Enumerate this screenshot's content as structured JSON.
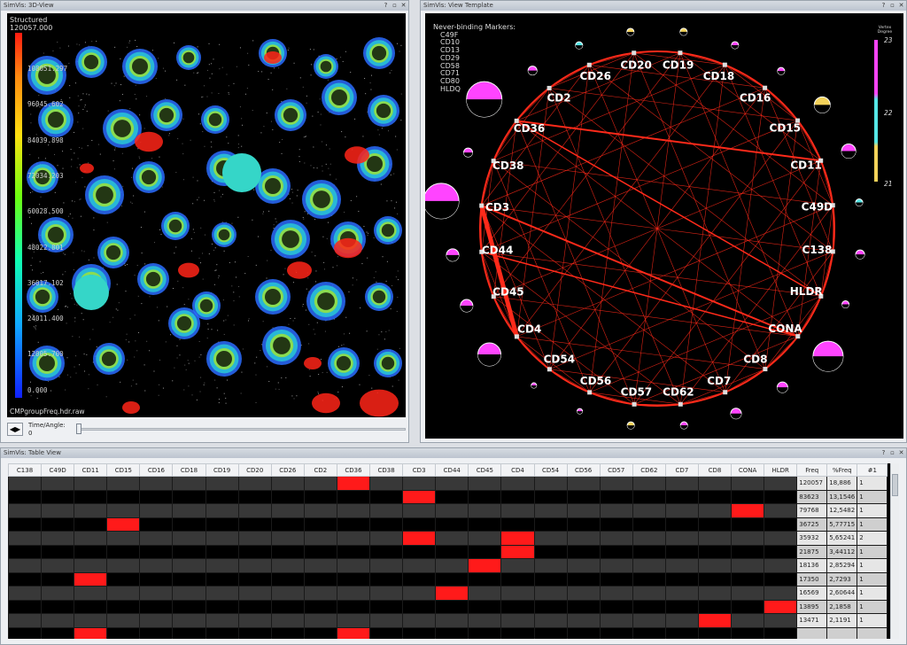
{
  "view3d": {
    "title": "SimVis: 3D-View",
    "colorbar_title_1": "Structured",
    "colorbar_title_2": "120057.000",
    "colorbar_labels": [
      "108051.297",
      "96045.602",
      "84039.898",
      "72034.203",
      "60028.500",
      "48022.801",
      "36017.102",
      "24011.400",
      "12005.700",
      "0.000"
    ],
    "filename": "CMPgroupFreq.hdr.raw",
    "time_label": "Time/Angle:",
    "time_value": "0",
    "time_button": "◀▶"
  },
  "graph": {
    "title": "SimVis: View Template",
    "never_binding_title": "Never-binding Markers:",
    "never_binding": [
      "C49F",
      "CD10",
      "CD13",
      "CD29",
      "CD58",
      "CD71",
      "CD80",
      "HLDQ"
    ],
    "legend_title": "Vertex Degree",
    "legend_values": [
      "23",
      "22",
      "21"
    ],
    "nodes": [
      "CD19",
      "CD18",
      "CD16",
      "CD15",
      "CD11",
      "C49D",
      "C138",
      "HLDR",
      "CONA",
      "CD8",
      "CD7",
      "CD62",
      "CD57",
      "CD56",
      "CD54",
      "CD4",
      "CD45",
      "CD44",
      "CD3",
      "CD38",
      "CD36",
      "CD2",
      "CD26",
      "CD20"
    ]
  },
  "table": {
    "title": "SimVis: Table View",
    "columns": [
      "C138",
      "C49D",
      "CD11",
      "CD15",
      "CD16",
      "CD18",
      "CD19",
      "CD20",
      "CD26",
      "CD2",
      "CD36",
      "CD38",
      "CD3",
      "CD44",
      "CD45",
      "CD4",
      "CD54",
      "CD56",
      "CD57",
      "CD62",
      "CD7",
      "CD8",
      "CONA",
      "HLDR"
    ],
    "num_columns": [
      "Freq",
      "%Freq",
      "#1"
    ],
    "rows": [
      {
        "on": [
          10
        ],
        "freq": "120057",
        "pct": "18,886",
        "n": "1"
      },
      {
        "on": [
          12
        ],
        "freq": "83623",
        "pct": "13,1546",
        "n": "1"
      },
      {
        "on": [
          22
        ],
        "freq": "79768",
        "pct": "12,5482",
        "n": "1"
      },
      {
        "on": [
          3
        ],
        "freq": "36725",
        "pct": "5,77715",
        "n": "1"
      },
      {
        "on": [
          12,
          15
        ],
        "freq": "35932",
        "pct": "5,65241",
        "n": "2"
      },
      {
        "on": [
          15
        ],
        "freq": "21875",
        "pct": "3,44112",
        "n": "1"
      },
      {
        "on": [
          14
        ],
        "freq": "18136",
        "pct": "2,85294",
        "n": "1"
      },
      {
        "on": [
          2
        ],
        "freq": "17350",
        "pct": "2,7293",
        "n": "1"
      },
      {
        "on": [
          13
        ],
        "freq": "16569",
        "pct": "2,60644",
        "n": "1"
      },
      {
        "on": [
          23
        ],
        "freq": "13895",
        "pct": "2,1858",
        "n": "1"
      },
      {
        "on": [
          21
        ],
        "freq": "13471",
        "pct": "2,1191",
        "n": "1"
      },
      {
        "on": [
          2,
          10
        ],
        "freq": "",
        "pct": "",
        "n": ""
      }
    ]
  },
  "colors": {
    "edge": "#ff2a1a",
    "magenta": "#ff44ff",
    "cyan": "#55e6e6",
    "yellow": "#f3d25a",
    "cell_on": "#ff1a1a"
  }
}
